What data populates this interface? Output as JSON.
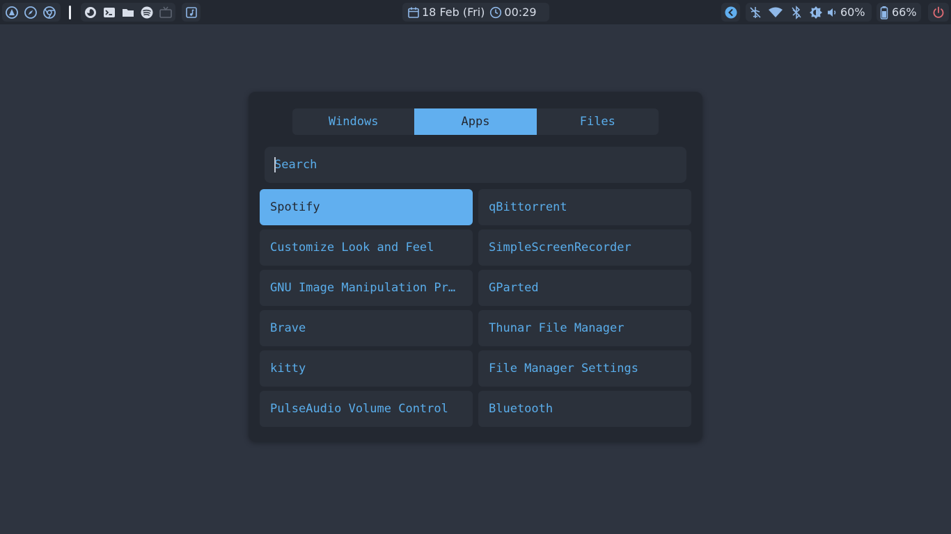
{
  "colors": {
    "desktop": "#2e3440",
    "bar": "#232831",
    "pill": "#2b313b",
    "accent": "#61afef",
    "icon_light": "#d8dee9",
    "power": "#e06c75"
  },
  "topbar": {
    "left_icons": [
      "arch-settings-icon",
      "compass-icon",
      "chrome-icon"
    ],
    "app_icons": [
      "firefox-icon",
      "terminal-icon",
      "folder-icon",
      "spotify-icon",
      "tv-icon"
    ],
    "music_icon": "music-note-icon",
    "date": "18 Feb (Fri)",
    "time": "00:29",
    "tray_icons": [
      "back-arrow-icon",
      "airplane-mode-off-icon",
      "wifi-icon",
      "bluetooth-icon",
      "brightness-icon",
      "volume-icon",
      "battery-icon",
      "power-icon"
    ],
    "volume": "60%",
    "battery": "66%"
  },
  "launcher": {
    "tabs": [
      {
        "label": "Windows"
      },
      {
        "label": "Apps"
      },
      {
        "label": "Files"
      }
    ],
    "active_tab": "Apps",
    "search": {
      "placeholder": "Search",
      "value": ""
    },
    "apps": [
      {
        "label": "Spotify",
        "selected": true
      },
      {
        "label": "qBittorrent",
        "selected": false
      },
      {
        "label": "Customize Look and Feel",
        "selected": false
      },
      {
        "label": "SimpleScreenRecorder",
        "selected": false
      },
      {
        "label": "GNU Image Manipulation Program",
        "selected": false
      },
      {
        "label": "GParted",
        "selected": false
      },
      {
        "label": "Brave",
        "selected": false
      },
      {
        "label": "Thunar File Manager",
        "selected": false
      },
      {
        "label": "kitty",
        "selected": false
      },
      {
        "label": "File Manager Settings",
        "selected": false
      },
      {
        "label": "PulseAudio Volume Control",
        "selected": false
      },
      {
        "label": "Bluetooth",
        "selected": false
      }
    ]
  }
}
